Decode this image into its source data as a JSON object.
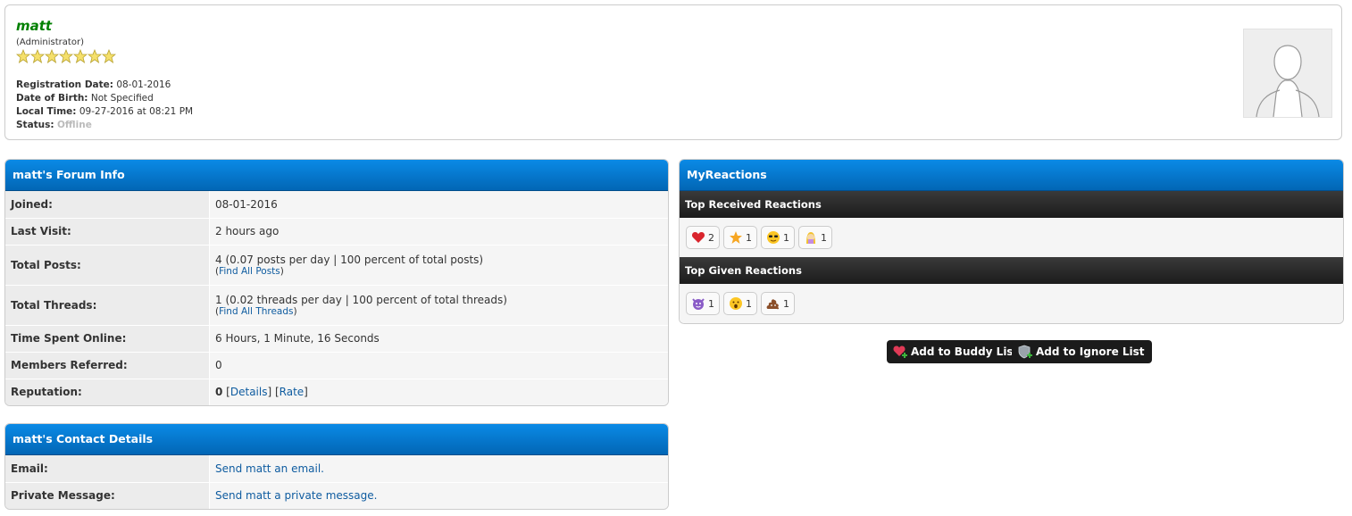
{
  "profile": {
    "username": "matt",
    "usertitle": "(Administrator)",
    "stars": 7,
    "registration_label": "Registration Date:",
    "registration_value": "08-01-2016",
    "dob_label": "Date of Birth:",
    "dob_value": "Not Specified",
    "localtime_label": "Local Time:",
    "localtime_value": "09-27-2016 at 08:21 PM",
    "status_label": "Status:",
    "status_value": "Offline"
  },
  "forum_info": {
    "title": "matt's Forum Info",
    "rows": [
      {
        "label": "Joined:",
        "value": "08-01-2016"
      },
      {
        "label": "Last Visit:",
        "value": "2 hours ago"
      },
      {
        "label": "Total Posts:",
        "value": "4 (0.07 posts per day | 100 percent of total posts)",
        "link": "Find All Posts"
      },
      {
        "label": "Total Threads:",
        "value": "1 (0.02 threads per day | 100 percent of total threads)",
        "link": "Find All Threads"
      },
      {
        "label": "Time Spent Online:",
        "value": "6 Hours, 1 Minute, 16 Seconds"
      },
      {
        "label": "Members Referred:",
        "value": "0"
      },
      {
        "label": "Reputation:",
        "value": "0",
        "details": "Details",
        "rate": "Rate"
      }
    ]
  },
  "contact": {
    "title": "matt's Contact Details",
    "email_label": "Email:",
    "email_link": "Send matt an email.",
    "pm_label": "Private Message:",
    "pm_link": "Send matt a private message."
  },
  "reactions": {
    "title": "MyReactions",
    "received_title": "Top Received Reactions",
    "received": [
      {
        "icon": "heart-icon",
        "count": "2"
      },
      {
        "icon": "star-icon",
        "count": "1"
      },
      {
        "icon": "sunglasses-face-icon",
        "count": "1"
      },
      {
        "icon": "facepalm-woman-icon",
        "count": "1"
      }
    ],
    "given_title": "Top Given Reactions",
    "given": [
      {
        "icon": "devil-face-icon",
        "count": "1"
      },
      {
        "icon": "surprised-face-icon",
        "count": "1"
      },
      {
        "icon": "poop-icon",
        "count": "1"
      }
    ]
  },
  "buttons": {
    "buddy": "Add to Buddy List",
    "ignore": "Add to Ignore List"
  },
  "colors": {
    "header_blue": "#0a8ae6",
    "username_green": "#008000",
    "link_blue": "#0f5ca0"
  }
}
